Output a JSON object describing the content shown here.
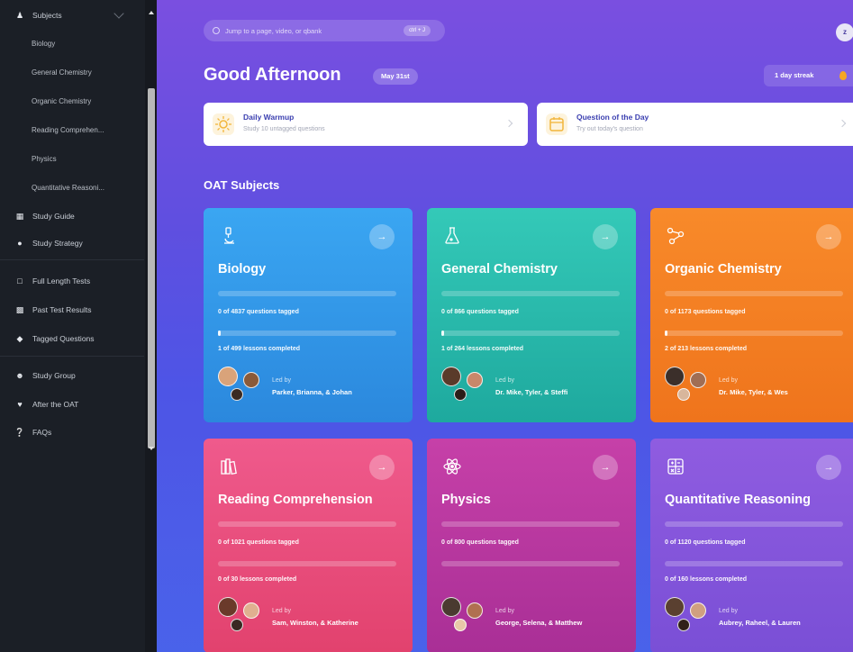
{
  "sidebar": {
    "subjects_label": "Subjects",
    "subjects": [
      "Biology",
      "General Chemistry",
      "Organic Chemistry",
      "Reading Comprehen...",
      "Physics",
      "Quantitative Reasoni..."
    ],
    "study_guide": "Study Guide",
    "study_strategy": "Study Strategy",
    "full_length_tests": "Full Length Tests",
    "past_test_results": "Past Test Results",
    "tagged_questions": "Tagged Questions",
    "study_group": "Study Group",
    "after_the_oat": "After the OAT",
    "faqs": "FAQs"
  },
  "header": {
    "search_placeholder": "Jump to a page, video, or qbank",
    "shortcut": "ctrl + J",
    "avatar_initial": "z",
    "greeting": "Good Afternoon",
    "date": "May 31st",
    "streak": "1 day streak"
  },
  "quick": {
    "warmup_title": "Daily Warmup",
    "warmup_sub": "Study 10 untagged questions",
    "qotd_title": "Question of the Day",
    "qotd_sub": "Try out today's question"
  },
  "section_title": "OAT Subjects",
  "cards": [
    {
      "title": "Biology",
      "tagged": "0 of 4837 questions tagged",
      "tagged_frac": 0,
      "lessons": "1 of 499 lessons completed",
      "lessons_frac": 0.002,
      "led_by": "Led by",
      "leaders": "Parker, Brianna, & Johan",
      "icon": "microscope-icon",
      "color_top": "#3aa6f2",
      "color_bottom": "#2b88dd"
    },
    {
      "title": "General Chemistry",
      "tagged": "0 of 866 questions tagged",
      "tagged_frac": 0,
      "lessons": "1 of 264 lessons completed",
      "lessons_frac": 0.004,
      "led_by": "Led by",
      "leaders": "Dr. Mike, Tyler, & Steffi",
      "icon": "flask-icon",
      "color_top": "#34c9b8",
      "color_bottom": "#1ea99e"
    },
    {
      "title": "Organic Chemistry",
      "tagged": "0 of 1173 questions tagged",
      "tagged_frac": 0,
      "lessons": "2 of 213 lessons completed",
      "lessons_frac": 0.01,
      "led_by": "Led by",
      "leaders": "Dr. Mike, Tyler, & Wes",
      "icon": "molecule-icon",
      "color_top": "#f88a2a",
      "color_bottom": "#ef741c"
    },
    {
      "title": "Reading Comprehension",
      "tagged": "0 of 1021 questions tagged",
      "tagged_frac": 0,
      "lessons": "0 of 30 lessons completed",
      "lessons_frac": 0,
      "led_by": "Led by",
      "leaders": "Sam, Winston, & Katherine",
      "icon": "books-icon",
      "color_top": "#ef5a8c",
      "color_bottom": "#e2426e"
    },
    {
      "title": "Physics",
      "tagged": "0 of 800 questions tagged",
      "tagged_frac": 0,
      "lessons": "",
      "lessons_frac": 0,
      "led_by": "Led by",
      "leaders": "George, Selena, & Matthew",
      "icon": "atom-icon",
      "color_top": "#c640a8",
      "color_bottom": "#a92f96"
    },
    {
      "title": "Quantitative Reasoning",
      "tagged": "0 of 1120 questions tagged",
      "tagged_frac": 0,
      "lessons": "0 of 160 lessons completed",
      "lessons_frac": 0,
      "led_by": "Led by",
      "leaders": "Aubrey, Raheel, & Lauren",
      "icon": "calculator-icon",
      "color_top": "#8f5ce0",
      "color_bottom": "#7a4fd6"
    }
  ]
}
